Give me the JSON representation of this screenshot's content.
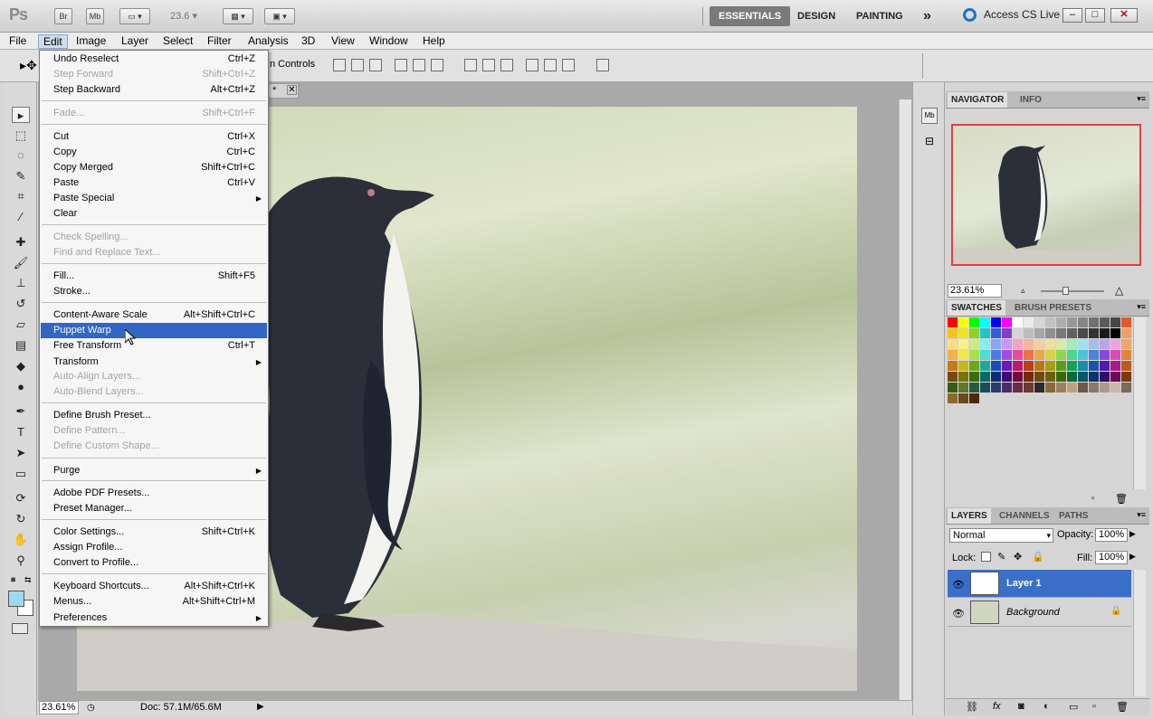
{
  "app": {
    "logo": "Ps",
    "bridge": "Br",
    "minibridge": "Mb",
    "zoom_display": "23.6",
    "workspaces": [
      "ESSENTIALS",
      "DESIGN",
      "PAINTING"
    ],
    "more_workspaces": "»",
    "access_cs_live": "Access CS Live"
  },
  "menubar": [
    "File",
    "Edit",
    "Image",
    "Layer",
    "Select",
    "Filter",
    "Analysis",
    "3D",
    "View",
    "Window",
    "Help"
  ],
  "options_bar": {
    "transform_controls_label": "n Controls"
  },
  "edit_menu": {
    "items": [
      {
        "label": "Undo Reselect",
        "shortcut": "Ctrl+Z",
        "disabled": false
      },
      {
        "label": "Step Forward",
        "shortcut": "Shift+Ctrl+Z",
        "disabled": true
      },
      {
        "label": "Step Backward",
        "shortcut": "Alt+Ctrl+Z",
        "disabled": false
      },
      {
        "label": "Fade...",
        "shortcut": "Shift+Ctrl+F",
        "disabled": true
      },
      {
        "label": "Cut",
        "shortcut": "Ctrl+X",
        "disabled": false
      },
      {
        "label": "Copy",
        "shortcut": "Ctrl+C",
        "disabled": false
      },
      {
        "label": "Copy Merged",
        "shortcut": "Shift+Ctrl+C",
        "disabled": false
      },
      {
        "label": "Paste",
        "shortcut": "Ctrl+V",
        "disabled": false
      },
      {
        "label": "Paste Special",
        "shortcut": "",
        "disabled": false
      },
      {
        "label": "Clear",
        "shortcut": "",
        "disabled": false
      },
      {
        "label": "Check Spelling...",
        "shortcut": "",
        "disabled": true
      },
      {
        "label": "Find and Replace Text...",
        "shortcut": "",
        "disabled": true
      },
      {
        "label": "Fill...",
        "shortcut": "Shift+F5",
        "disabled": false
      },
      {
        "label": "Stroke...",
        "shortcut": "",
        "disabled": false
      },
      {
        "label": "Content-Aware Scale",
        "shortcut": "Alt+Shift+Ctrl+C",
        "disabled": false
      },
      {
        "label": "Puppet Warp",
        "shortcut": "",
        "disabled": false
      },
      {
        "label": "Free Transform",
        "shortcut": "Ctrl+T",
        "disabled": false
      },
      {
        "label": "Transform",
        "shortcut": "",
        "disabled": false
      },
      {
        "label": "Auto-Align Layers...",
        "shortcut": "",
        "disabled": true
      },
      {
        "label": "Auto-Blend Layers...",
        "shortcut": "",
        "disabled": true
      },
      {
        "label": "Define Brush Preset...",
        "shortcut": "",
        "disabled": false
      },
      {
        "label": "Define Pattern...",
        "shortcut": "",
        "disabled": true
      },
      {
        "label": "Define Custom Shape...",
        "shortcut": "",
        "disabled": true
      },
      {
        "label": "Purge",
        "shortcut": "",
        "disabled": false
      },
      {
        "label": "Adobe PDF Presets...",
        "shortcut": "",
        "disabled": false
      },
      {
        "label": "Preset Manager...",
        "shortcut": "",
        "disabled": false
      },
      {
        "label": "Color Settings...",
        "shortcut": "Shift+Ctrl+K",
        "disabled": false
      },
      {
        "label": "Assign Profile...",
        "shortcut": "",
        "disabled": false
      },
      {
        "label": "Convert to Profile...",
        "shortcut": "",
        "disabled": false
      },
      {
        "label": "Keyboard Shortcuts...",
        "shortcut": "Alt+Shift+Ctrl+K",
        "disabled": false
      },
      {
        "label": "Menus...",
        "shortcut": "Alt+Shift+Ctrl+M",
        "disabled": false
      },
      {
        "label": "Preferences",
        "shortcut": "",
        "disabled": false
      }
    ],
    "selected_item": "Puppet Warp"
  },
  "document": {
    "tab_suffix": "*",
    "zoom": "23.61%",
    "doc_info": "Doc: 57.1M/65.6M"
  },
  "navigator": {
    "tabs": [
      "NAVIGATOR",
      "INFO"
    ],
    "zoom": "23.61%"
  },
  "swatches": {
    "tabs": [
      "SWATCHES",
      "BRUSH PRESETS"
    ]
  },
  "layers_panel": {
    "tabs": [
      "LAYERS",
      "CHANNELS",
      "PATHS"
    ],
    "blend_mode": "Normal",
    "opacity_label": "Opacity:",
    "opacity": "100%",
    "lock_label": "Lock:",
    "fill_label": "Fill:",
    "fill": "100%",
    "layers": [
      {
        "name": "Layer 1",
        "selected": true
      },
      {
        "name": "Background",
        "selected": false
      }
    ]
  },
  "colors": {
    "selection_blue": "#3066c4",
    "foreground": "#9fd8f0",
    "background": "#ffffff"
  }
}
